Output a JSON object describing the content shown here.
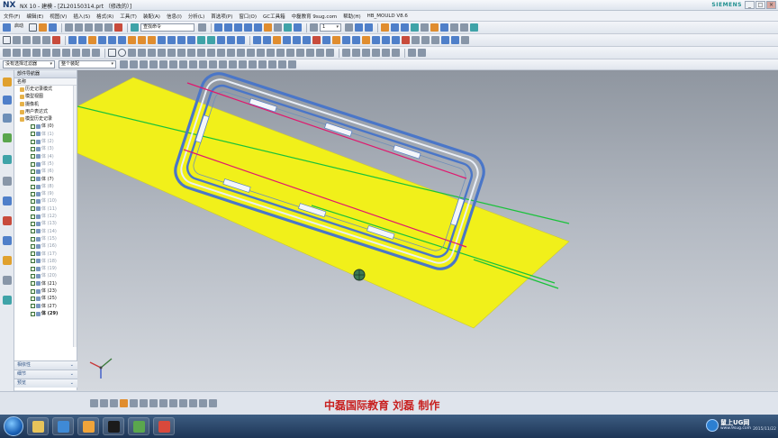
{
  "titlebar": {
    "logo": "NX",
    "title": "NX 10 - 建模 - [ZL20150314.prt （修改的）]",
    "brand": "SIEMENS",
    "buttons": [
      "_",
      "□",
      "×"
    ]
  },
  "menu": {
    "items": [
      "文件(F)",
      "编辑(E)",
      "视图(V)",
      "插入(S)",
      "格式(R)",
      "工具(T)",
      "装配(A)",
      "信息(I)",
      "分析(L)",
      "首选项(P)",
      "窗口(O)",
      "GC工具箱",
      "中磊教育 9sug.com",
      "帮助(H)",
      "HB_MOULD V8.6"
    ]
  },
  "toolbar": {
    "start_label": "启动",
    "command_search_placeholder": "查找命令",
    "layer_value": "1",
    "filter_value": "没有选择过滤器",
    "assembly_value": "整个装配"
  },
  "navigator": {
    "title": "部件导航器",
    "column_name": "名称",
    "nodes": [
      {
        "label": "历史记录模式",
        "kind": "folder",
        "dim": false,
        "bold": false
      },
      {
        "label": "模型视图",
        "kind": "folder",
        "dim": false,
        "bold": false
      },
      {
        "label": "摄像机",
        "kind": "folder",
        "dim": false,
        "bold": false
      },
      {
        "label": "用户表达式",
        "kind": "folder",
        "dim": false,
        "bold": false
      },
      {
        "label": "模型历史记录",
        "kind": "folder",
        "dim": false,
        "bold": false
      },
      {
        "label": "体 (0)",
        "kind": "body",
        "dim": false,
        "bold": false
      },
      {
        "label": "体 (1)",
        "kind": "body",
        "dim": true,
        "bold": false
      },
      {
        "label": "体 (2)",
        "kind": "body",
        "dim": true,
        "bold": false
      },
      {
        "label": "体 (3)",
        "kind": "body",
        "dim": true,
        "bold": false
      },
      {
        "label": "体 (4)",
        "kind": "body",
        "dim": true,
        "bold": false
      },
      {
        "label": "体 (5)",
        "kind": "body",
        "dim": true,
        "bold": false
      },
      {
        "label": "体 (6)",
        "kind": "body",
        "dim": true,
        "bold": false
      },
      {
        "label": "体 (7)",
        "kind": "body",
        "dim": false,
        "bold": false
      },
      {
        "label": "体 (8)",
        "kind": "body",
        "dim": true,
        "bold": false
      },
      {
        "label": "体 (9)",
        "kind": "body",
        "dim": true,
        "bold": false
      },
      {
        "label": "体 (10)",
        "kind": "body",
        "dim": true,
        "bold": false
      },
      {
        "label": "体 (11)",
        "kind": "body",
        "dim": true,
        "bold": false
      },
      {
        "label": "体 (12)",
        "kind": "body",
        "dim": true,
        "bold": false
      },
      {
        "label": "体 (13)",
        "kind": "body",
        "dim": true,
        "bold": false
      },
      {
        "label": "体 (14)",
        "kind": "body",
        "dim": true,
        "bold": false
      },
      {
        "label": "体 (15)",
        "kind": "body",
        "dim": true,
        "bold": false
      },
      {
        "label": "体 (16)",
        "kind": "body",
        "dim": true,
        "bold": false
      },
      {
        "label": "体 (17)",
        "kind": "body",
        "dim": true,
        "bold": false
      },
      {
        "label": "体 (18)",
        "kind": "body",
        "dim": true,
        "bold": false
      },
      {
        "label": "体 (19)",
        "kind": "body",
        "dim": true,
        "bold": false
      },
      {
        "label": "体 (20)",
        "kind": "body",
        "dim": true,
        "bold": false
      },
      {
        "label": "体 (21)",
        "kind": "body",
        "dim": false,
        "bold": false
      },
      {
        "label": "体 (23)",
        "kind": "body",
        "dim": false,
        "bold": false
      },
      {
        "label": "体 (25)",
        "kind": "body",
        "dim": false,
        "bold": false
      },
      {
        "label": "体 (27)",
        "kind": "body",
        "dim": false,
        "bold": false
      },
      {
        "label": "体 (29)",
        "kind": "body",
        "dim": false,
        "bold": true
      }
    ],
    "panels": [
      "相依性",
      "细节",
      "预览"
    ]
  },
  "graphics": {
    "sheet_color": "#f1f01a",
    "tool_color": "#4a76c8",
    "line_green": "#19c23a",
    "line_red": "#e0186e"
  },
  "caption": "中磊国际教育 刘磊 制作",
  "taskbar": {
    "tray_logo_title": "鼠上UG网",
    "tray_logo_url": "www.9sug.com",
    "date": "2015/11/22"
  }
}
